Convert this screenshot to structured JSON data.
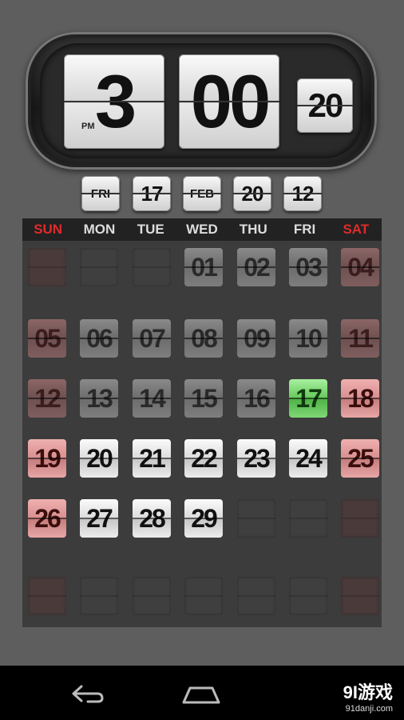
{
  "clock": {
    "hour": "3",
    "minute": "00",
    "second": "20",
    "ampm": "PM"
  },
  "date_tiles": {
    "weekday": "FRI",
    "day": "17",
    "month": "FEB",
    "year_century": "20",
    "year_short": "12"
  },
  "calendar": {
    "weekdays": [
      "SUN",
      "MON",
      "TUE",
      "WED",
      "THU",
      "FRI",
      "SAT"
    ],
    "weekend_color": "#e02a2a",
    "today": "17",
    "today_color": "#66c95c",
    "rows": [
      [
        "",
        "",
        "",
        "01",
        "02",
        "03",
        "04"
      ],
      [
        "05",
        "06",
        "07",
        "08",
        "09",
        "10",
        "11"
      ],
      [
        "12",
        "13",
        "14",
        "15",
        "16",
        "17",
        "18"
      ],
      [
        "19",
        "20",
        "21",
        "22",
        "23",
        "24",
        "25"
      ],
      [
        "26",
        "27",
        "28",
        "29",
        "",
        "",
        ""
      ],
      [
        "",
        "",
        "",
        "",
        "",
        "",
        ""
      ]
    ]
  },
  "navbar": {
    "back_icon": "back-icon",
    "home_icon": "home-icon"
  },
  "watermark": {
    "logo": "9Ɩ游戏",
    "url": "91danji.com"
  }
}
